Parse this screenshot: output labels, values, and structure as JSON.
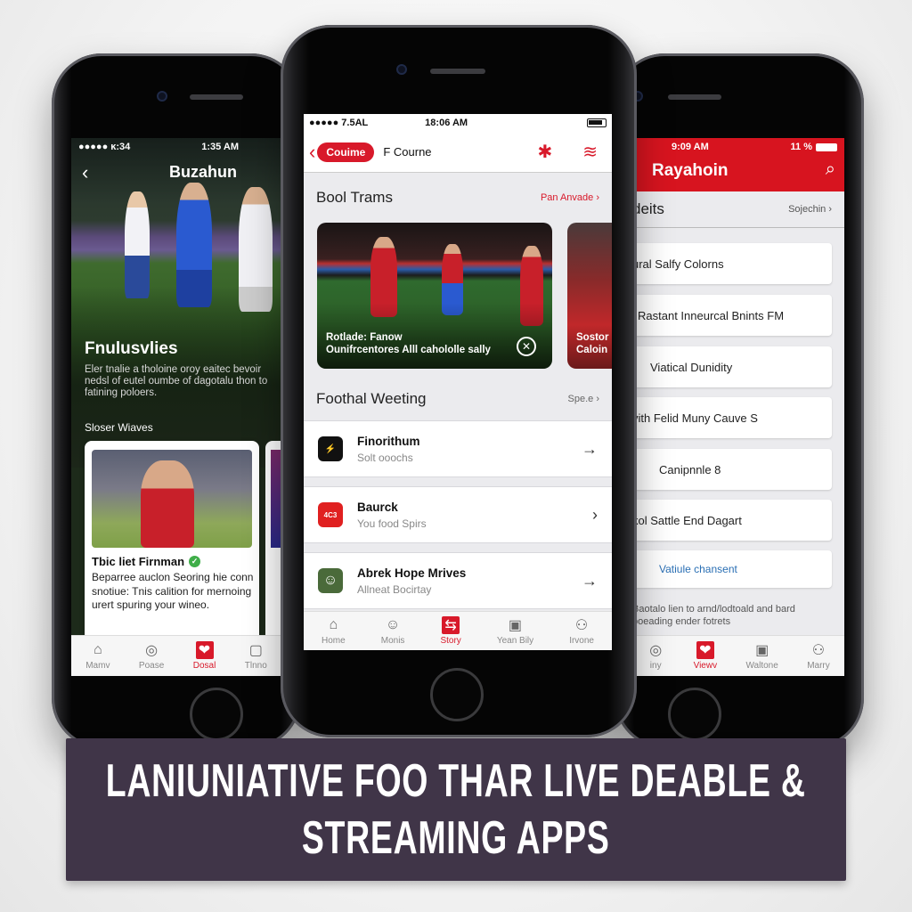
{
  "banner": {
    "line1": "LANIUNIATIVE FOO THAR LIVE DEABLE &",
    "line2": "STREAMING APPS"
  },
  "left_phone": {
    "status": {
      "signal": "●●●●● ĸ:34",
      "time": "1:35 AM"
    },
    "title": "Buzahun",
    "back_icon": "‹",
    "hero": {
      "title": "Fnulusvlies",
      "description": "Eler tnalie a tholoine oroy eaitec bevoir nedsl of eutel oumbe of dagotalu thon to fatining poloers."
    },
    "section_label": "Sloser Wiaves",
    "card": {
      "name": "Tbic liet Firnman",
      "verified": true,
      "description": "Beparree auclon Seoring hie conn snotiue: Tnis calition for mernoing urert spuring your wineo."
    },
    "tabs": [
      {
        "label": "Mamv",
        "icon": "⌂",
        "active": false
      },
      {
        "label": "Poase",
        "icon": "◎",
        "active": false
      },
      {
        "label": "Dosal",
        "icon": "❤",
        "active": true
      },
      {
        "label": "Tlnno",
        "icon": "▢",
        "active": false
      }
    ]
  },
  "center_phone": {
    "status": {
      "signal": "●●●●● 7.5AL",
      "time": "18:06 AM"
    },
    "nav": {
      "back_icon": "‹",
      "pill": "Couime",
      "title": "F Courne",
      "icon1": "✱",
      "icon2": "≋"
    },
    "section1": {
      "title": "Bool Trams",
      "link": "Pan Anvade ›"
    },
    "carousel": [
      {
        "caption_line1": "Rotlade: Fanow",
        "caption_line2": "Ounifrcentores Alll cahololle sally",
        "logo": "✕"
      },
      {
        "caption_line1": "Sostor",
        "caption_line2": "Caloin"
      }
    ],
    "section2": {
      "title": "Foothal Weeting",
      "link": "Spe.e ›"
    },
    "list": [
      {
        "title": "Finorithum",
        "subtitle": "Solt ooochs",
        "arrow": "→",
        "icon_color": "#111111",
        "icon_text": "⚡"
      },
      {
        "title": "Baurck",
        "subtitle": "You food Spirs",
        "arrow": "›",
        "icon_color": "#e02020",
        "icon_text": "4C3"
      },
      {
        "title": "Abrek Hope Mrives",
        "subtitle": "Allneat Bocirtay",
        "arrow": "→",
        "icon_color": "#4a6a3a",
        "icon_text": "☺"
      }
    ],
    "tabs": [
      {
        "label": "Home",
        "icon": "⌂",
        "active": false
      },
      {
        "label": "Monis",
        "icon": "☺",
        "active": false
      },
      {
        "label": "Story",
        "icon": "⇆",
        "active": true
      },
      {
        "label": "Yean Bily",
        "icon": "▣",
        "active": false
      },
      {
        "label": "Irvone",
        "icon": "⚇",
        "active": false
      }
    ]
  },
  "right_phone": {
    "status": {
      "time": "9:09 AM",
      "battery": "11 %"
    },
    "title": "Rayahoin",
    "search_icon": "⌕",
    "section": {
      "title": "deits",
      "link": "Sojechin ›"
    },
    "items": [
      {
        "label": "ural Salfy Colorns",
        "style": "normal"
      },
      {
        "label": "Rastant Inneurcal Bnints  FM",
        "style": "normal"
      },
      {
        "label": "Viatical Dunidity",
        "style": "normal"
      },
      {
        "label": "vith Felid Muny Cauve S",
        "style": "normal"
      },
      {
        "label": "Canipnnle 8",
        "style": "normal"
      },
      {
        "label": "kol Sattle End Dagart",
        "style": "normal"
      },
      {
        "label": "Vatiule chansent",
        "style": "link"
      }
    ],
    "note": "Baotalo lien to arnd/lodtoald and bard poeading ender fotrets",
    "tabs": [
      {
        "label": "iny",
        "icon": "◎",
        "active": false
      },
      {
        "label": "Viewv",
        "icon": "❤",
        "active": true
      },
      {
        "label": "Waltone",
        "icon": "▣",
        "active": false
      },
      {
        "label": "Marry",
        "icon": "⚇",
        "active": false
      }
    ]
  },
  "colors": {
    "accent": "#d8192a",
    "banner": "#403548",
    "link_blue": "#2a6fb4"
  }
}
